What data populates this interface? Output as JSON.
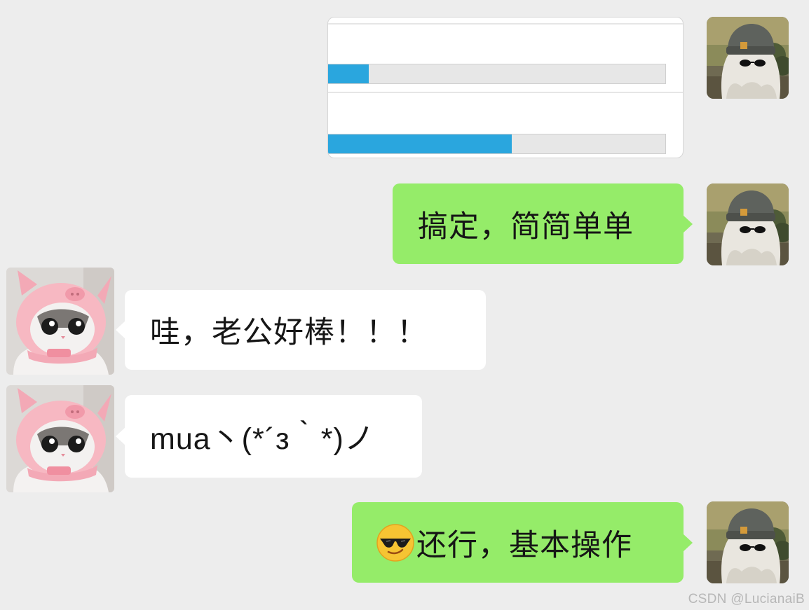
{
  "screenshot_card": {
    "progress_bars": [
      {
        "value": 0.12
      },
      {
        "value": 0.545
      }
    ],
    "colors": {
      "fill": "#2aa6de",
      "track": "#e7e7e7"
    }
  },
  "messages": [
    {
      "sender": "self",
      "avatar_icon": "ghost-beanie-avatar",
      "text": "搞定，简简单单"
    },
    {
      "sender": "other",
      "avatar_icon": "pig-hat-cat-avatar",
      "text": "哇，老公好棒！！！"
    },
    {
      "sender": "other",
      "avatar_icon": "pig-hat-cat-avatar",
      "text": "mua丶(*´з｀*)ノ"
    },
    {
      "sender": "self",
      "avatar_icon": "ghost-beanie-avatar",
      "emoji_icon": "sunglasses-smiley-emoji",
      "text": "还行，基本操作"
    }
  ],
  "colors": {
    "background": "#ededed",
    "self_bubble": "#95ec69",
    "other_bubble": "#ffffff"
  },
  "watermark": "CSDN @LucianaiB"
}
